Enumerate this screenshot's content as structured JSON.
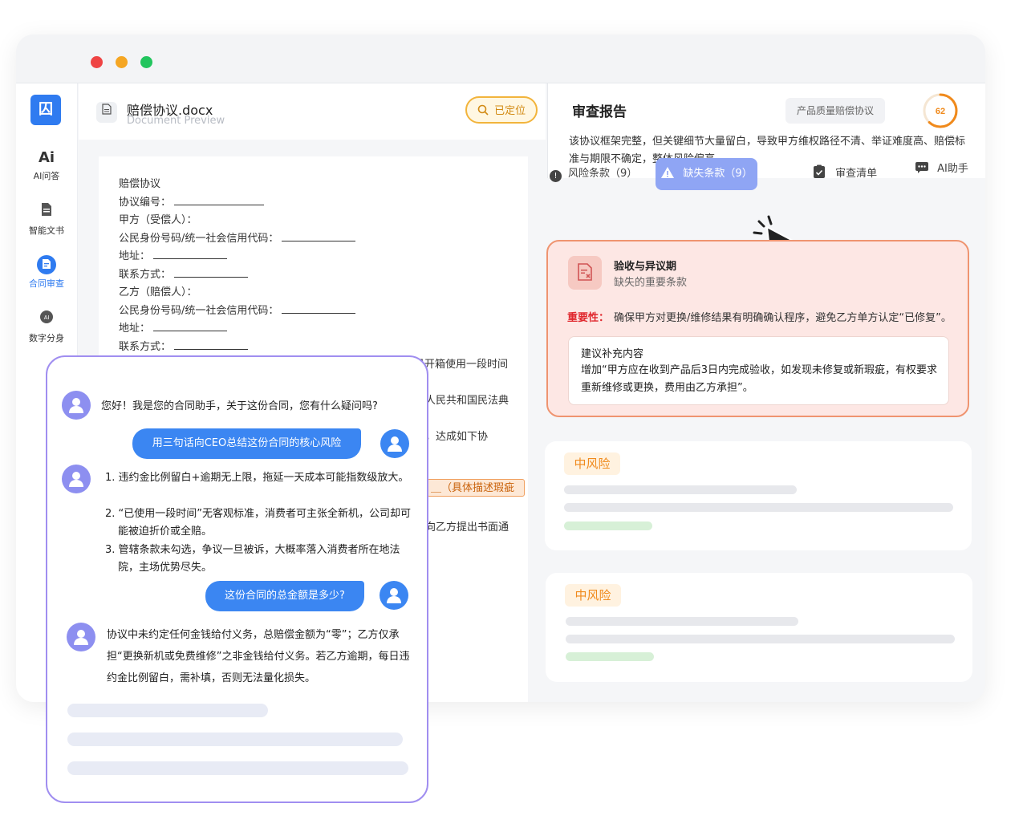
{
  "sidebar": {
    "logo": "囚",
    "items": [
      {
        "label": "AI问答",
        "icon": "ai-icon"
      },
      {
        "label": "智能文书",
        "icon": "document-icon"
      },
      {
        "label": "合同审查",
        "icon": "contract-review-icon",
        "active": true
      },
      {
        "label": "数字分身",
        "icon": "digital-avatar-icon"
      }
    ]
  },
  "document": {
    "filename": "赔偿协议.docx",
    "subtitle": "Document Preview",
    "locate_label": "已定位",
    "lines": [
      "赔偿协议",
      "协议编号：",
      "甲方（受偿人）：",
      "公民身份号码/统一社会信用代码：",
      "地址：",
      "联系方式：",
      "乙方（赔偿人）：",
      "公民身份号码/统一社会信用代码：",
      "地址：",
      "联系方式："
    ],
    "fragments": [
      "已开箱使用一段时间",
      "人民共和国民法典",
      "，达成如下协",
      "向乙方提出书面通"
    ],
    "highlight": "＿（具体描述瑕疵"
  },
  "report": {
    "title": "审查报告",
    "tag": "产品质量赔偿协议",
    "score": "62",
    "summary": "该协议框架完整，但关键细节大量留白，导致甲方维权路径不清、举证难度高、赔偿标准与期限不确定，整体风险偏高"
  },
  "tabs": [
    {
      "label": "风险条款（9）"
    },
    {
      "label": "缺失条款（9）",
      "active": true
    },
    {
      "label": "审查清单"
    },
    {
      "label": "AI助手"
    }
  ],
  "missing": {
    "title": "验收与异议期",
    "subtitle": "缺失的重要条款",
    "importance_label": "重要性：",
    "importance_text": "确保甲方对更换/维修结果有明确确认程序，避免乙方单方认定“已修复”。",
    "suggest_title": "建议补充内容",
    "suggest_text": "增加“甲方应在收到产品后3日内完成验收，如发现未修复或新瑕疵，有权要求重新维修或更换，费用由乙方承担”。"
  },
  "risk_cards": [
    {
      "level": "中风险"
    },
    {
      "level": "中风险"
    }
  ],
  "chat": {
    "greeting": "您好！我是您的合同助手，关于这份合同，您有什么疑问吗?",
    "user_q1": "用三句话向CEO总结这份合同的核心风险",
    "answer1": [
      "1. 违约金比例留白+逾期无上限，拖延一天成本可能指数级放大。",
      "2. “已使用一段时间”无客观标准，消费者可主张全新机，公司却可能被迫折价或全赔。",
      "3. 管辖条款未勾选，争议一旦被诉，大概率落入消费者所在地法院，主场优势尽失。"
    ],
    "user_q2": "这份合同的总金额是多少?",
    "answer2": "协议中未约定任何金钱给付义务，总赔偿金额为“零”；乙方仅承担“更换新机或免费维修”之非金钱给付义务。若乙方逾期，每日违约金比例留白，需补填，否则无法量化损失。"
  },
  "colors": {
    "primary": "#3b86f2",
    "accent_purple": "#a08ef0",
    "warning_orange": "#f08a1c",
    "danger_red": "#e0282e"
  }
}
